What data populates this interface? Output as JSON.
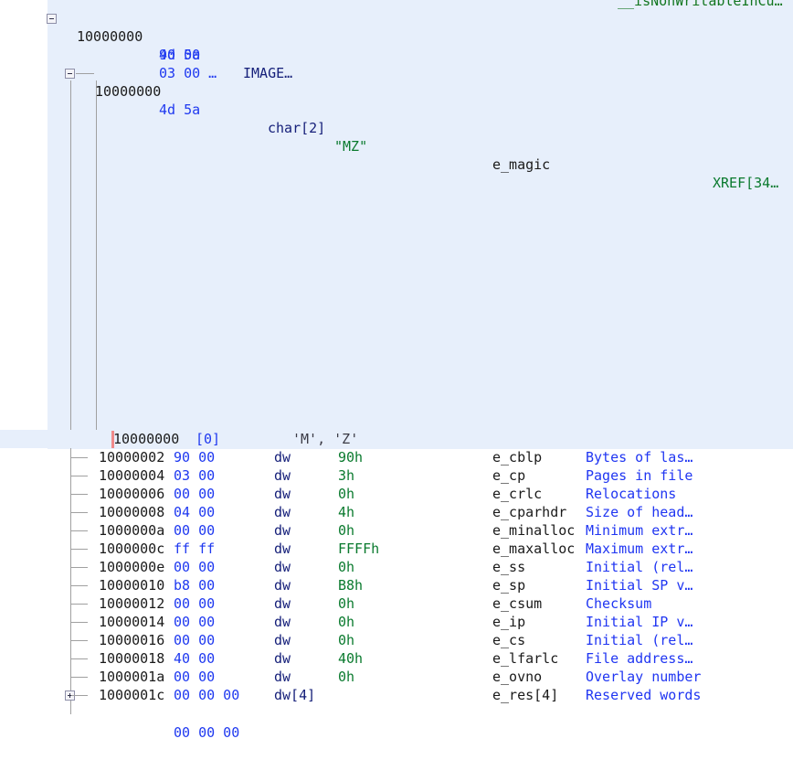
{
  "view": {
    "name": "ghidra-listing",
    "background": "#ffffff",
    "selection_color": "#e7effb",
    "cursor_color": "#f08a8a"
  },
  "header": {
    "label_top_right": "__isNonWritableInCu…",
    "collapsed_struct": {
      "address": "10000000",
      "bytes_lines": [
        "4d 5a",
        "90 00",
        "03 00 …"
      ],
      "type_label": "IMAGE…"
    },
    "magic_row": {
      "address": "10000000",
      "bytes": "4d 5a",
      "type": "char[2]",
      "value": "\"MZ\"",
      "fieldname": "e_magic",
      "xref": "XREF[34…"
    }
  },
  "icons": {
    "collapse_root": "minus-box-icon",
    "collapse_child": "minus-box-icon",
    "expand_res": "plus-box-icon"
  },
  "fields": [
    {
      "address": "10000000",
      "bytes": "[0]",
      "type": "",
      "value": "'M', 'Z'",
      "fieldname": "",
      "comment": "",
      "selected": true,
      "toggle": "none",
      "value_kind": "char"
    },
    {
      "address": "10000002",
      "bytes": "90 00",
      "type": "dw",
      "value": "90h",
      "fieldname": "e_cblp",
      "comment": "Bytes of las…",
      "selected": false,
      "toggle": "none",
      "value_kind": "num"
    },
    {
      "address": "10000004",
      "bytes": "03 00",
      "type": "dw",
      "value": "3h",
      "fieldname": "e_cp",
      "comment": "Pages in file",
      "selected": false,
      "toggle": "none",
      "value_kind": "num"
    },
    {
      "address": "10000006",
      "bytes": "00 00",
      "type": "dw",
      "value": "0h",
      "fieldname": "e_crlc",
      "comment": "Relocations",
      "selected": false,
      "toggle": "none",
      "value_kind": "num"
    },
    {
      "address": "10000008",
      "bytes": "04 00",
      "type": "dw",
      "value": "4h",
      "fieldname": "e_cparhdr",
      "comment": "Size of head…",
      "selected": false,
      "toggle": "none",
      "value_kind": "num"
    },
    {
      "address": "1000000a",
      "bytes": "00 00",
      "type": "dw",
      "value": "0h",
      "fieldname": "e_minalloc",
      "comment": "Minimum extr…",
      "selected": false,
      "toggle": "none",
      "value_kind": "num"
    },
    {
      "address": "1000000c",
      "bytes": "ff ff",
      "type": "dw",
      "value": "FFFFh",
      "fieldname": "e_maxalloc",
      "comment": "Maximum extr…",
      "selected": false,
      "toggle": "none",
      "value_kind": "num"
    },
    {
      "address": "1000000e",
      "bytes": "00 00",
      "type": "dw",
      "value": "0h",
      "fieldname": "e_ss",
      "comment": "Initial (rel…",
      "selected": false,
      "toggle": "none",
      "value_kind": "num"
    },
    {
      "address": "10000010",
      "bytes": "b8 00",
      "type": "dw",
      "value": "B8h",
      "fieldname": "e_sp",
      "comment": "Initial SP v…",
      "selected": false,
      "toggle": "none",
      "value_kind": "num"
    },
    {
      "address": "10000012",
      "bytes": "00 00",
      "type": "dw",
      "value": "0h",
      "fieldname": "e_csum",
      "comment": "Checksum",
      "selected": false,
      "toggle": "none",
      "value_kind": "num"
    },
    {
      "address": "10000014",
      "bytes": "00 00",
      "type": "dw",
      "value": "0h",
      "fieldname": "e_ip",
      "comment": "Initial IP v…",
      "selected": false,
      "toggle": "none",
      "value_kind": "num"
    },
    {
      "address": "10000016",
      "bytes": "00 00",
      "type": "dw",
      "value": "0h",
      "fieldname": "e_cs",
      "comment": "Initial (rel…",
      "selected": false,
      "toggle": "none",
      "value_kind": "num"
    },
    {
      "address": "10000018",
      "bytes": "40 00",
      "type": "dw",
      "value": "40h",
      "fieldname": "e_lfarlc",
      "comment": "File address…",
      "selected": false,
      "toggle": "none",
      "value_kind": "num"
    },
    {
      "address": "1000001a",
      "bytes": "00 00",
      "type": "dw",
      "value": "0h",
      "fieldname": "e_ovno",
      "comment": "Overlay number",
      "selected": false,
      "toggle": "none",
      "value_kind": "num"
    },
    {
      "address": "1000001c",
      "bytes": "00 00 00",
      "type": "dw[4]",
      "value": "",
      "fieldname": "e_res[4]",
      "comment": "Reserved words",
      "selected": false,
      "toggle": "plus",
      "value_kind": "none"
    }
  ],
  "continuation_row": {
    "bytes": "00 00 00"
  }
}
